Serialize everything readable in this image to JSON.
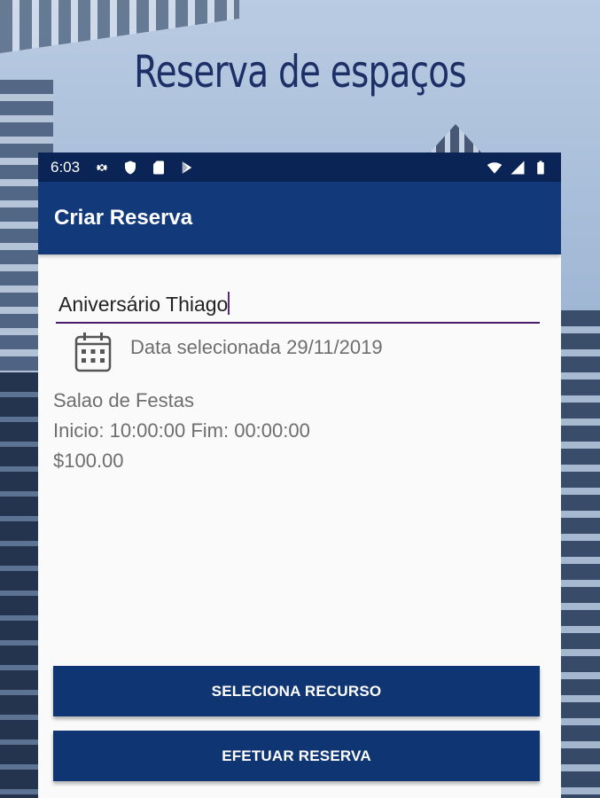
{
  "promo": {
    "headline": "Reserva de espaços"
  },
  "statusbar": {
    "time": "6:03",
    "left_icons": [
      "gear-icon",
      "shield-icon",
      "sd-card-icon",
      "play-store-icon"
    ],
    "right_icons": [
      "wifi-icon",
      "signal-icon",
      "battery-icon"
    ]
  },
  "appbar": {
    "title": "Criar Reserva"
  },
  "form": {
    "event_name_value": "Aniversário Thiago",
    "date_label": "Data selecionada 29/11/2019",
    "resource_name": "Salao de Festas",
    "time_range": "Inicio: 10:00:00 Fim: 00:00:00",
    "price": "$100.00"
  },
  "buttons": {
    "select_resource": "SELECIONA RECURSO",
    "make_reservation": "EFETUAR RESERVA"
  },
  "colors": {
    "statusbar": "#0b2456",
    "appbar": "#123a7a",
    "button": "#0f3573",
    "underline": "#4a1a6e",
    "headline": "#1c2f66"
  }
}
